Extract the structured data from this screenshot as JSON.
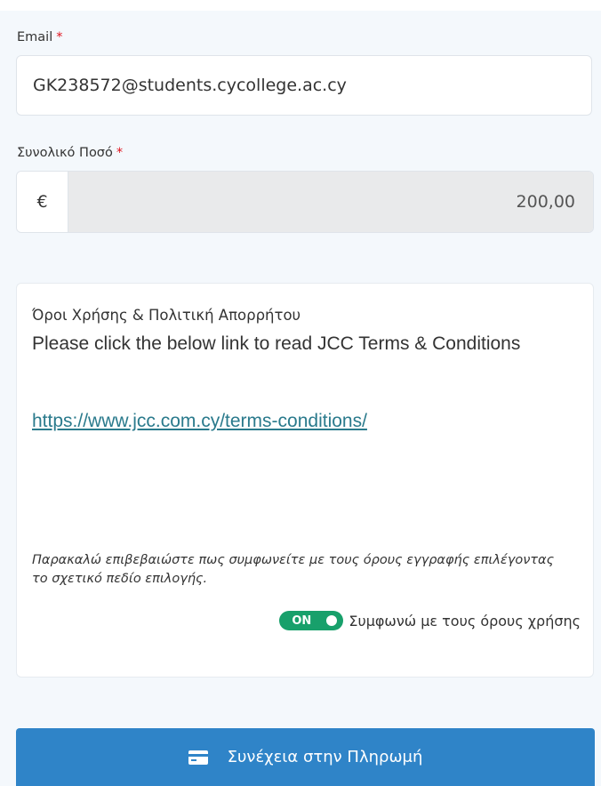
{
  "email": {
    "label": "Email",
    "required_mark": "*",
    "value": "GK238572@students.cycollege.ac.cy"
  },
  "amount": {
    "label": "Συνολικό Ποσό",
    "required_mark": "*",
    "currency_symbol": "€",
    "value": "200,00"
  },
  "terms": {
    "title": "Όροι Χρήσης & Πολιτική Απορρήτου",
    "text": "Please click the below link to read JCC Terms & Conditions",
    "link": "https://www.jcc.com.cy/terms-conditions/",
    "confirm_note": "Παρακαλώ επιβεβαιώστε πως συμφωνείτε με τους όρους εγγραφής επιλέγοντας το σχετικό πεδίο επιλογής.",
    "toggle_state": "ON",
    "toggle_label": "Συμφωνώ με τους όρους χρήσης"
  },
  "pay_button": {
    "label": "Συνέχεια στην Πληρωμή",
    "icon": "credit-card-icon"
  },
  "colors": {
    "primary_button": "#2f84c8",
    "toggle_on": "#18a06b",
    "required": "#e0141e",
    "link": "#2a7a8c"
  }
}
